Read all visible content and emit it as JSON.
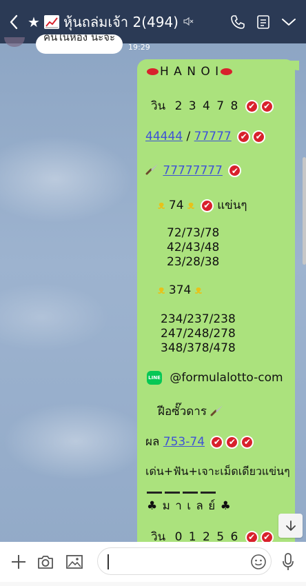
{
  "header": {
    "title": "หุ้นถล่มเจ้า 2(494)",
    "star": "★"
  },
  "received": {
    "text": "คนในห้อง นะจ๊ะ",
    "time": "19:29"
  },
  "message": {
    "hanoi": "H A N O I",
    "win_label": "วิน",
    "win_digits": "2 3 4 7 8",
    "link_a": "44444",
    "slash": "/",
    "link_b": "77777",
    "link_c": "77777777",
    "two_digit_main": "74",
    "tail_word": "แข่นๆ",
    "pairs_1": "72/73/78",
    "pairs_2": "42/43/48",
    "pairs_3": "23/28/38",
    "three_digit_main": "374",
    "trip_1": "234/237/238",
    "trip_2": "247/248/278",
    "trip_3": "348/378/478",
    "line_id": "@formulalotto-com",
    "signature": "ฝีอซั๊วดาร",
    "result_label": "ผล",
    "result_link": "753-74",
    "promo": "เด่น+ฟัน+เจาะเม็ดเดียวแข่นๆ",
    "malay": "ม า เ ล ย์",
    "win2_label": "วิน",
    "win2_digits": "0 1 2 5 6"
  },
  "colors": {
    "topbar": "#2b3a55",
    "bubble_sent": "#abe27d",
    "check_red": "#d8212c",
    "link": "#3e52d6"
  },
  "icons": [
    "back-icon",
    "star-icon",
    "chart-icon",
    "mute-icon",
    "phone-icon",
    "notes-icon",
    "chevron-down-icon",
    "add-icon",
    "camera-icon",
    "image-icon",
    "emoji-icon",
    "mic-icon",
    "scroll-down-icon"
  ]
}
